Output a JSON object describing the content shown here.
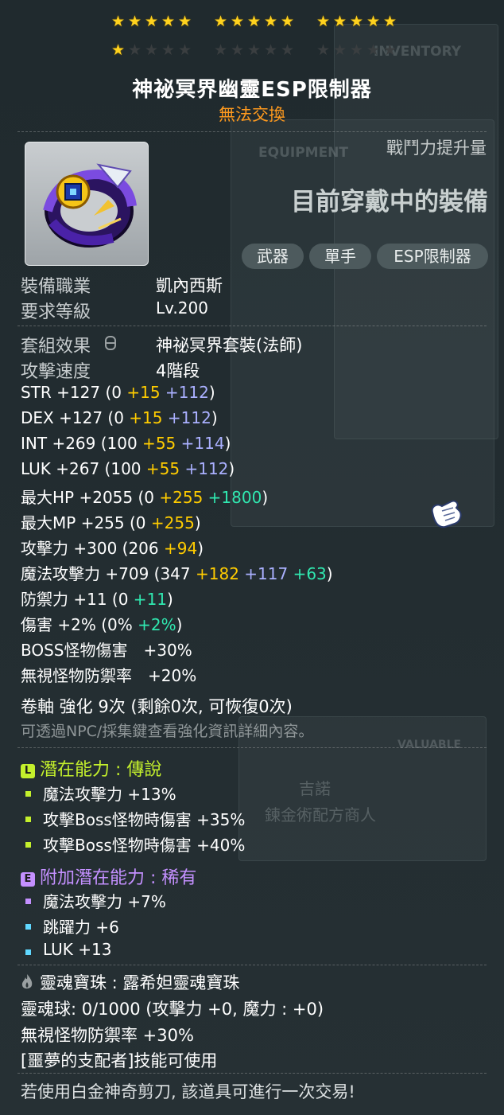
{
  "stars": {
    "rows": [
      {
        "groups": [
          5,
          5,
          5
        ],
        "filled": 15
      },
      {
        "groups": [
          5,
          5,
          5
        ],
        "filled": 1
      }
    ]
  },
  "item_name": "神祕冥界幽靈ESP限制器",
  "trade_status": "無法交換",
  "icon_name": "esp-limiter-icon",
  "cp_gain_label": "戰鬥力提升量",
  "equipped_label": "目前穿戴中的裝備",
  "tags": [
    "武器",
    "單手",
    "ESP限制器"
  ],
  "req": {
    "job_label": "裝備職業",
    "job_value": "凱內西斯",
    "level_label": "要求等級",
    "level_value": "Lv.200"
  },
  "set": {
    "label": "套組效果",
    "value": "神祕冥界套裝(法師)"
  },
  "speed": {
    "label": "攻擊速度",
    "value": "4階段"
  },
  "stats": [
    {
      "name": "STR",
      "total": "+127",
      "base": "0",
      "flame": "+15",
      "extra": "+112",
      "extra_color": "purple"
    },
    {
      "name": "DEX",
      "total": "+127",
      "base": "0",
      "flame": "+15",
      "extra": "+112",
      "extra_color": "purple"
    },
    {
      "name": "INT",
      "total": "+269",
      "base": "100",
      "flame": "+55",
      "extra": "+114",
      "extra_color": "purple"
    },
    {
      "name": "LUK",
      "total": "+267",
      "base": "100",
      "flame": "+55",
      "extra": "+112",
      "extra_color": "purple"
    },
    {
      "name": "最大HP",
      "total": "+2055",
      "base": "0",
      "flame": "+255",
      "extra": "+1800",
      "extra_color": "green"
    },
    {
      "name": "最大MP",
      "total": "+255",
      "base": "0",
      "flame": "+255",
      "extra": "",
      "extra_color": ""
    },
    {
      "name": "攻擊力",
      "total": "+300",
      "base": "206",
      "flame": "+94",
      "extra": "",
      "extra_color": ""
    },
    {
      "name": "魔法攻擊力",
      "total": "+709",
      "base": "347",
      "flame": "+182",
      "extra": "+117",
      "extra2": "+63",
      "extra_color": "purple"
    },
    {
      "name": "防禦力",
      "total": "+11",
      "base": "0",
      "flame": "",
      "extra": "+11",
      "extra_color": "green"
    },
    {
      "name": "傷害",
      "total": "+2%",
      "base": "0%",
      "flame": "",
      "extra": "+2%",
      "extra_color": "green"
    }
  ],
  "boss_damage": "BOSS怪物傷害　+30%",
  "ignore_def": "無視怪物防禦率　+20%",
  "scroll_text": "卷軸 強化 9次 (剩餘0次, 可恢復0次)",
  "scroll_hint": "可透過NPC/採集鍵查看強化資訊詳細內容。",
  "potential": {
    "title": "潛在能力 : 傳說",
    "badge": "L",
    "color": "#c4f02c",
    "lines": [
      "魔法攻擊力 +13%",
      "攻擊Boss怪物時傷害 +35%",
      "攻擊Boss怪物時傷害 +40%"
    ]
  },
  "bonus_potential": {
    "title": "附加潛在能力 : 稀有",
    "badge": "E",
    "color": "#c490ff",
    "lines": [
      "魔法攻擊力 +7%",
      "跳躍力 +6",
      "LUK +13"
    ]
  },
  "soul": {
    "title": "靈魂寶珠 : 露希妲靈魂寶珠",
    "gauge": "靈魂球: 0/1000 (攻擊力 +0, 魔力 : +0)",
    "option": "無視怪物防禦率 +30%",
    "skill": "[噩夢的支配者]技能可使用"
  },
  "footer": "若使用白金神奇剪刀, 該道具可進行一次交易!",
  "background_labels": [
    "EQUIPMENT",
    "INVENTORY",
    "VALUABLE",
    "吉諾",
    "鍊金術配方商人"
  ]
}
